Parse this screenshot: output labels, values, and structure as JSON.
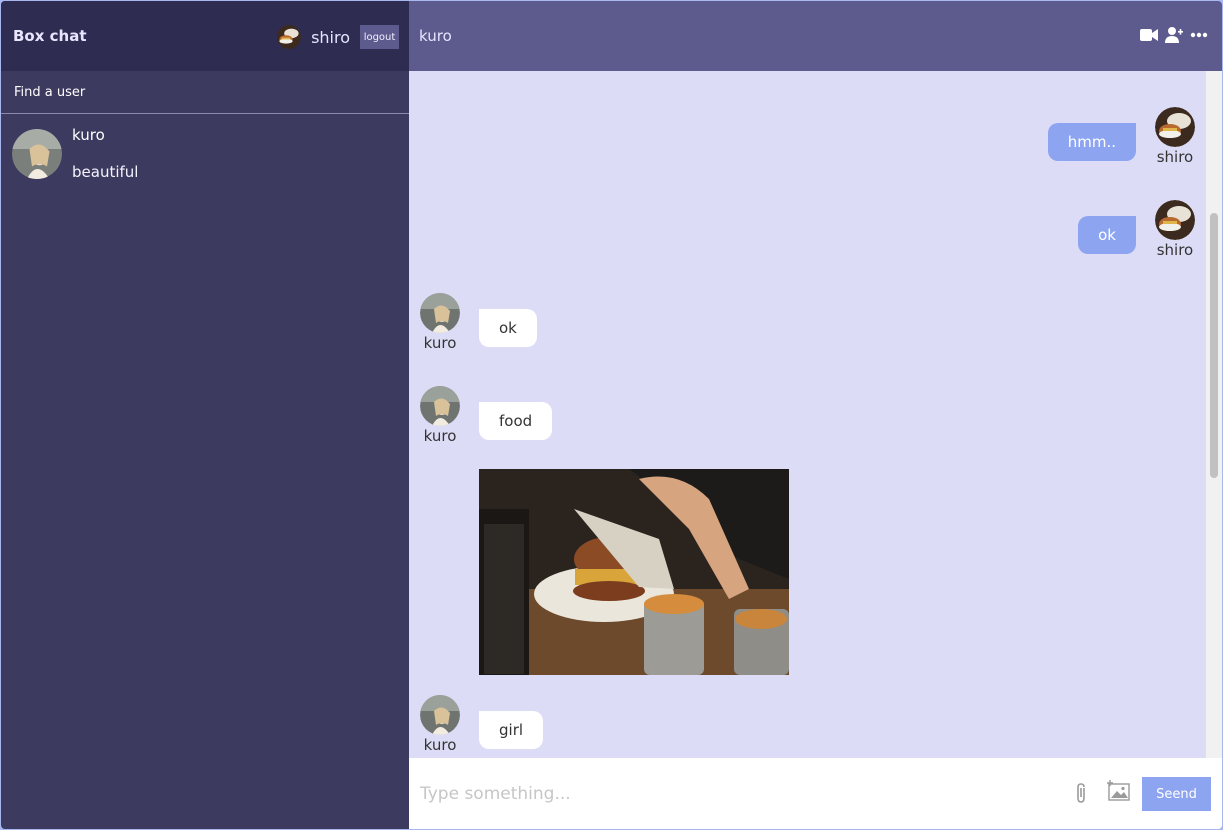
{
  "sidebar": {
    "brand": "Box chat",
    "current_user": "shiro",
    "logout_label": "logout",
    "search_placeholder": "Find a user",
    "chats": [
      {
        "name": "kuro",
        "last_message": "beautiful"
      }
    ]
  },
  "chat": {
    "title": "kuro",
    "messages": [
      {
        "sender": "shiro",
        "own": true,
        "text": "hmm.."
      },
      {
        "sender": "shiro",
        "own": true,
        "text": "ok"
      },
      {
        "sender": "kuro",
        "own": false,
        "text": "ok"
      },
      {
        "sender": "kuro",
        "own": false,
        "text": "food",
        "has_image": true
      },
      {
        "sender": "kuro",
        "own": false,
        "text": "girl"
      }
    ],
    "input_placeholder": "Type something...",
    "send_label": "Seend"
  },
  "colors": {
    "sidebar_bg": "#3d3a5f",
    "sidebar_header": "#2f2c51",
    "chat_header": "#5d5b8d",
    "chat_bg": "#dddcf6",
    "own_bubble": "#8da4f1",
    "send_button": "#8da4f1"
  },
  "icons": [
    "video-camera-icon",
    "add-user-icon",
    "more-icon",
    "paperclip-icon",
    "image-icon"
  ]
}
